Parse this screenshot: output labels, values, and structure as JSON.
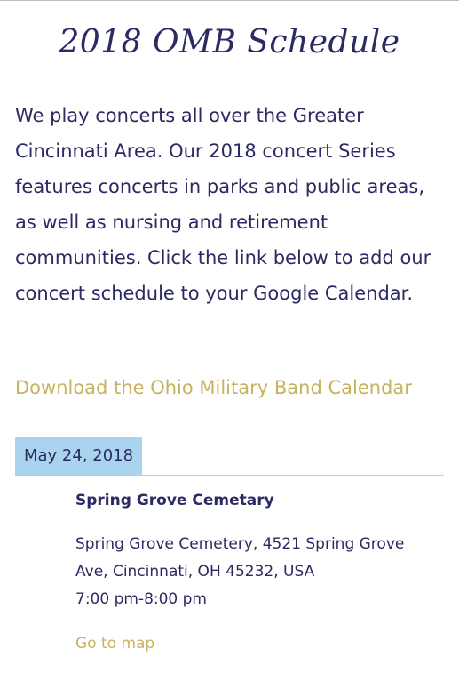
{
  "page": {
    "title": "2018 OMB Schedule",
    "intro": "We play concerts all over the Greater Cincinnati Area. Our 2018 concert Series features concerts in parks and public areas, as well as nursing and retirement communities. Click the link below to add our concert schedule to your Google Calendar.",
    "download_link": "Download the Ohio Military Band Calendar"
  },
  "events": [
    {
      "date": "May 24, 2018",
      "venue": "Spring Grove Cemetary",
      "address": "Spring Grove Cemetery, 4521 Spring Grove Ave, Cincinnati, OH 45232, USA",
      "time": "7:00 pm-8:00 pm",
      "map_link": "Go to map"
    }
  ],
  "colors": {
    "text": "#2b2a62",
    "link": "#c9b25f",
    "date_badge_bg": "#aad4ee",
    "divider": "#aad4ee"
  }
}
